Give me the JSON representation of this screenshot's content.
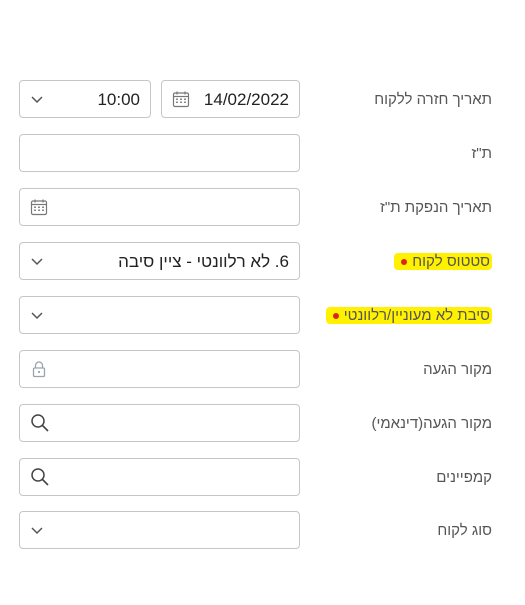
{
  "form": {
    "return_date_label": "תאריך חזרה ללקוח",
    "return_date_value": "14/02/2022",
    "return_time_value": "10:00",
    "id_label": "ת\"ז",
    "id_value": "",
    "id_issue_date_label": "תאריך הנפקת ת\"ז",
    "id_issue_date_value": "",
    "status_label": "סטטוס לקוח",
    "status_value": "6. לא רלוונטי - ציין סיבה",
    "reason_label": "סיבת לא מעוניין/רלוונטי",
    "reason_value": "",
    "source_label": "מקור הגעה",
    "source_value": "",
    "dynamic_source_label": "מקור הגעה(דינאמי)",
    "dynamic_source_value": "",
    "campaigns_label": "קמפיינים",
    "campaigns_value": "",
    "customer_type_label": "סוג לקוח",
    "customer_type_value": ""
  },
  "colors": {
    "highlight": "#fff100",
    "required": "#d9261c",
    "border": "#c6c6c6"
  },
  "icons": [
    "calendar-icon",
    "chevron-down-icon",
    "lock-icon",
    "search-icon"
  ]
}
